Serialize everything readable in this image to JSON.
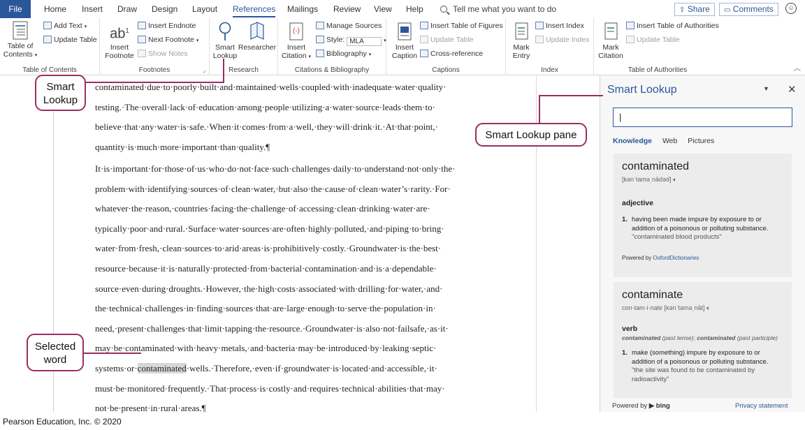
{
  "tabs": {
    "file": "File",
    "items": [
      "Home",
      "Insert",
      "Draw",
      "Design",
      "Layout",
      "References",
      "Mailings",
      "Review",
      "View",
      "Help"
    ],
    "active": "References",
    "tell_me": "Tell me what you want to do",
    "share": "Share",
    "comments": "Comments"
  },
  "ribbon": {
    "toc": {
      "big_line1": "Table of",
      "big_line2": "Contents",
      "add_text": "Add Text",
      "update_table": "Update Table",
      "label": "Table of Contents"
    },
    "footnotes": {
      "big_ab": "ab",
      "big_ab_sup": "1",
      "big_line1": "Insert",
      "big_line2": "Footnote",
      "insert_endnote": "Insert Endnote",
      "next_footnote": "Next Footnote",
      "show_notes": "Show Notes",
      "label": "Footnotes"
    },
    "research": {
      "smart_line1": "Smart",
      "smart_line2": "Lookup",
      "researcher": "Researcher",
      "label": "Research"
    },
    "citations": {
      "big_line1": "Insert",
      "big_line2": "Citation",
      "manage_sources": "Manage Sources",
      "style_label": "Style:",
      "style_value": "MLA",
      "bibliography": "Bibliography",
      "label": "Citations & Bibliography"
    },
    "captions": {
      "big_line1": "Insert",
      "big_line2": "Caption",
      "insert_table_of_figures": "Insert Table of Figures",
      "update_table": "Update Table",
      "cross_reference": "Cross-reference",
      "label": "Captions"
    },
    "index": {
      "big_line1": "Mark",
      "big_line2": "Entry",
      "insert_index": "Insert Index",
      "update_index": "Update Index",
      "label": "Index"
    },
    "authorities": {
      "big_line1": "Mark",
      "big_line2": "Citation",
      "insert_table": "Insert Table of Authorities",
      "update_table": "Update Table",
      "label": "Table of Authorities"
    }
  },
  "document": {
    "para1": [
      "contaminated·due·to·poorly·built·and·maintained·wells·coupled·with·inadequate·water·quality·",
      "testing.·The·overall·lack·of·education·among·people·utilizing·a·water·source·leads·them·to·",
      "believe·that·any·water·is·safe.·When·it·comes·from·a·well,·they·will·drink·it.·At·that·point,·",
      "quantity·is·much·more·important·than·quality.¶"
    ],
    "para2": [
      "It·is·important·for·those·of·us·who·do·not·face·such·challenges·daily·to·understand·not·only·the·",
      "problem·with·identifying·sources·of·clean·water,·but·also·the·cause·of·clean·water’s·rarity.·For·",
      "whatever·the·reason,·countries·facing·the·challenge·of·accessing·clean·drinking·water·are·",
      "typically·poor·and·rural.·Surface·water·sources·are·often·highly·polluted,·and·piping·to·bring·",
      "water·from·fresh,·clean·sources·to·arid·areas·is·prohibitively·costly.·Groundwater·is·the·best·",
      "resource·because·it·is·naturally·protected·from·bacterial·contamination·and·is·a·dependable·",
      "source·even·during·droughts.·However,·the·high·costs·associated·with·drilling·for·water,·and·",
      "the·technical·challenges·in·finding·sources·that·are·large·enough·to·serve·the·population·in·",
      "need,·present·challenges·that·limit·tapping·the·resource.·Groundwater·is·also·not·failsafe,·as·it·",
      "may·be·contaminated·with·heavy·metals,·and·bacteria·may·be·introduced·by·leaking·septic·"
    ],
    "sel_before": "systems·or·",
    "sel_word": "contaminated",
    "sel_after": "·wells.·Therefore,·even·if·groundwater·is·located·and·accessible,·it·",
    "para2_end": [
      "must·be·monitored·frequently.·That·process·is·costly·and·requires·technical·abilities·that·may·",
      "not·be·present·in·rural·areas.¶"
    ]
  },
  "pane": {
    "title": "Smart Lookup",
    "search_value": "|",
    "tabs": [
      "Knowledge",
      "Web",
      "Pictures"
    ],
    "active_tab": "Knowledge",
    "card1": {
      "word": "contaminated",
      "pron": "[kənˈtaməˌnādəd]",
      "pos": "adjective",
      "num": "1.",
      "definition": "having been made impure by exposure to or addition of a poisonous or polluting substance.",
      "example": "\"contaminated blood products\"",
      "powered_prefix": "Powered by ",
      "powered_link": "OxfordDictionaries"
    },
    "card2": {
      "word": "contaminate",
      "pron": "con·tam·i·nate [kənˈtaməˌnāt]",
      "pos": "verb",
      "forms_w1": "contaminated",
      "forms_t1": " (past tense); ",
      "forms_w2": "contaminated",
      "forms_t2": " (past participle)",
      "num": "1.",
      "definition": "make (something) impure by exposure to or addition of a poisonous or polluting substance.",
      "example": "\"the site was found to be contaminated by radioactivity\""
    },
    "footer_powered": "Powered by",
    "footer_bing": "bing",
    "footer_privacy": "Privacy statement"
  },
  "callouts": {
    "smart_lookup_line1": "Smart",
    "smart_lookup_line2": "Lookup",
    "pane": "Smart Lookup pane",
    "selected_line1": "Selected",
    "selected_line2": "word"
  },
  "copyright": "Pearson Education, Inc. © 2020",
  "colors": {
    "accent": "#2b579a",
    "callout_border": "#9b2d63",
    "selection": "#d7d7d7"
  },
  "icons": [
    "search-icon",
    "smiley-icon",
    "share-icon",
    "comments-icon",
    "table-of-contents-icon",
    "footnote-icon",
    "smart-lookup-icon",
    "researcher-icon",
    "citation-icon",
    "caption-icon",
    "mark-entry-icon",
    "mark-citation-icon",
    "speaker-icon",
    "bing-logo-icon"
  ]
}
